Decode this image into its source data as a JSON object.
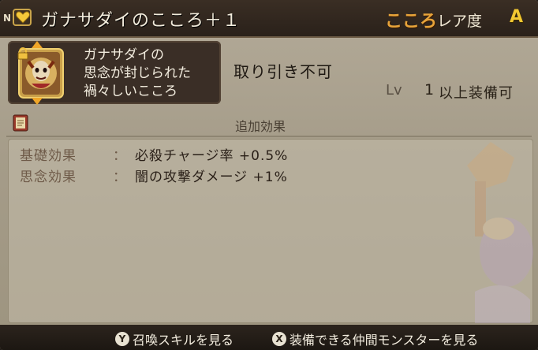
{
  "header": {
    "rank_badge": "N",
    "title": "ガナサダイのこころ＋１",
    "category_label": "こころ",
    "rarity_label": "レア度",
    "rarity_value": "A"
  },
  "item": {
    "description_lines": [
      "ガナサダイの",
      "思念が封じられた",
      "禍々しいこころ"
    ],
    "trade_status": "取り引き不可",
    "level_label": "Lv",
    "level_value": "1",
    "level_suffix": "以上装備可"
  },
  "effects": {
    "section_title": "追加効果",
    "rows": [
      {
        "label": "基礎効果",
        "colon": "：",
        "value": "必殺チャージ率 +0.5%"
      },
      {
        "label": "思念効果",
        "colon": "：",
        "value": "闇の攻撃ダメージ +1%"
      }
    ]
  },
  "footer": {
    "hints": [
      {
        "button": "Y",
        "label": "召喚スキルを見る"
      },
      {
        "button": "X",
        "label": "装備できる仲間モンスターを見る"
      }
    ]
  },
  "icons": {
    "heart": "heart-icon",
    "lock": "lock-icon",
    "book": "book-icon",
    "arrows": [
      "arrow-up-icon",
      "arrow-down-icon"
    ]
  },
  "colors": {
    "accent_orange": "#e8a43a",
    "rarity_yellow": "#f2c832",
    "arrow_orange": "#f0a628"
  }
}
